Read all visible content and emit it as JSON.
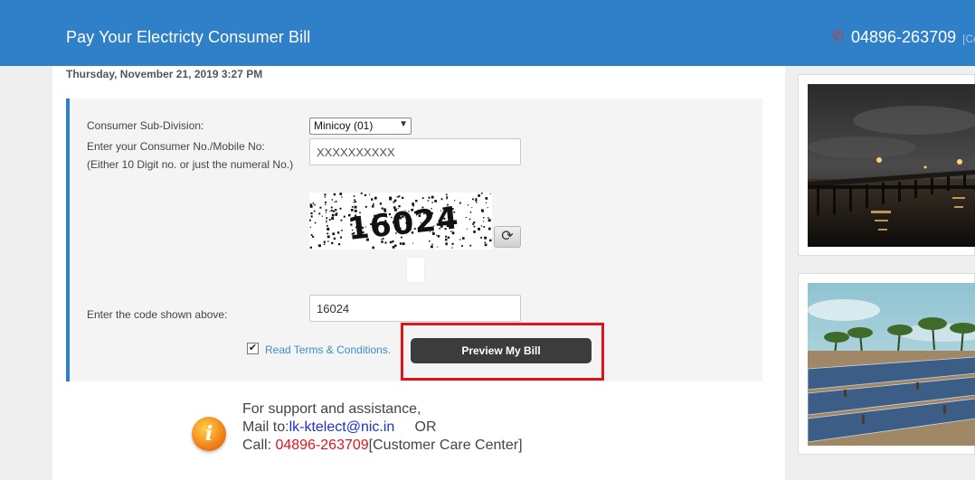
{
  "header": {
    "title": "Pay Your Electricty Consumer Bill",
    "phone_icon": "phone-icon",
    "phone": "04896-263709",
    "phone_suffix": "[Co"
  },
  "datetime": "Thursday, November 21, 2019 3:27 PM",
  "form": {
    "subdivision_label": "Consumer Sub-Division:",
    "subdivision_value": "Minicoy (01)",
    "consumer_label": "Enter your Consumer No./Mobile No: (Either 10 Digit no. or just the numeral No.)",
    "consumer_value": "XXXXXXXXXX",
    "captcha_text": "16024",
    "refresh_icon": "refresh-icon",
    "code_label": "Enter the code shown above:",
    "code_value": "16024",
    "terms_label": "Read Terms & Conditions.",
    "terms_checked": true,
    "preview_button": "Preview My Bill"
  },
  "support": {
    "icon": "info-icon",
    "line1": "For support and assistance,",
    "mail_prefix": "Mail to:",
    "mail_address": "lk-ktelect@nic.in",
    "or_text": "OR",
    "call_prefix": "Call: ",
    "call_number": "04896-263709",
    "call_suffix": "[Customer Care Center]"
  },
  "colors": {
    "header_bg": "#2f80c8",
    "button_bg": "#3c3c3c",
    "highlight": "#e0151b",
    "link": "#3a8fc7"
  }
}
